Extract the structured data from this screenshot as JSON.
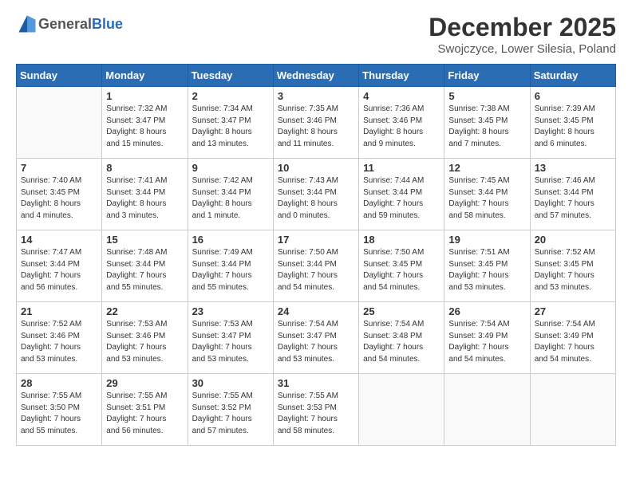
{
  "header": {
    "logo_general": "General",
    "logo_blue": "Blue",
    "month": "December 2025",
    "location": "Swojczyce, Lower Silesia, Poland"
  },
  "weekdays": [
    "Sunday",
    "Monday",
    "Tuesday",
    "Wednesday",
    "Thursday",
    "Friday",
    "Saturday"
  ],
  "weeks": [
    [
      {
        "day": "",
        "info": ""
      },
      {
        "day": "1",
        "info": "Sunrise: 7:32 AM\nSunset: 3:47 PM\nDaylight: 8 hours\nand 15 minutes."
      },
      {
        "day": "2",
        "info": "Sunrise: 7:34 AM\nSunset: 3:47 PM\nDaylight: 8 hours\nand 13 minutes."
      },
      {
        "day": "3",
        "info": "Sunrise: 7:35 AM\nSunset: 3:46 PM\nDaylight: 8 hours\nand 11 minutes."
      },
      {
        "day": "4",
        "info": "Sunrise: 7:36 AM\nSunset: 3:46 PM\nDaylight: 8 hours\nand 9 minutes."
      },
      {
        "day": "5",
        "info": "Sunrise: 7:38 AM\nSunset: 3:45 PM\nDaylight: 8 hours\nand 7 minutes."
      },
      {
        "day": "6",
        "info": "Sunrise: 7:39 AM\nSunset: 3:45 PM\nDaylight: 8 hours\nand 6 minutes."
      }
    ],
    [
      {
        "day": "7",
        "info": "Sunrise: 7:40 AM\nSunset: 3:45 PM\nDaylight: 8 hours\nand 4 minutes."
      },
      {
        "day": "8",
        "info": "Sunrise: 7:41 AM\nSunset: 3:44 PM\nDaylight: 8 hours\nand 3 minutes."
      },
      {
        "day": "9",
        "info": "Sunrise: 7:42 AM\nSunset: 3:44 PM\nDaylight: 8 hours\nand 1 minute."
      },
      {
        "day": "10",
        "info": "Sunrise: 7:43 AM\nSunset: 3:44 PM\nDaylight: 8 hours\nand 0 minutes."
      },
      {
        "day": "11",
        "info": "Sunrise: 7:44 AM\nSunset: 3:44 PM\nDaylight: 7 hours\nand 59 minutes."
      },
      {
        "day": "12",
        "info": "Sunrise: 7:45 AM\nSunset: 3:44 PM\nDaylight: 7 hours\nand 58 minutes."
      },
      {
        "day": "13",
        "info": "Sunrise: 7:46 AM\nSunset: 3:44 PM\nDaylight: 7 hours\nand 57 minutes."
      }
    ],
    [
      {
        "day": "14",
        "info": "Sunrise: 7:47 AM\nSunset: 3:44 PM\nDaylight: 7 hours\nand 56 minutes."
      },
      {
        "day": "15",
        "info": "Sunrise: 7:48 AM\nSunset: 3:44 PM\nDaylight: 7 hours\nand 55 minutes."
      },
      {
        "day": "16",
        "info": "Sunrise: 7:49 AM\nSunset: 3:44 PM\nDaylight: 7 hours\nand 55 minutes."
      },
      {
        "day": "17",
        "info": "Sunrise: 7:50 AM\nSunset: 3:44 PM\nDaylight: 7 hours\nand 54 minutes."
      },
      {
        "day": "18",
        "info": "Sunrise: 7:50 AM\nSunset: 3:45 PM\nDaylight: 7 hours\nand 54 minutes."
      },
      {
        "day": "19",
        "info": "Sunrise: 7:51 AM\nSunset: 3:45 PM\nDaylight: 7 hours\nand 53 minutes."
      },
      {
        "day": "20",
        "info": "Sunrise: 7:52 AM\nSunset: 3:45 PM\nDaylight: 7 hours\nand 53 minutes."
      }
    ],
    [
      {
        "day": "21",
        "info": "Sunrise: 7:52 AM\nSunset: 3:46 PM\nDaylight: 7 hours\nand 53 minutes."
      },
      {
        "day": "22",
        "info": "Sunrise: 7:53 AM\nSunset: 3:46 PM\nDaylight: 7 hours\nand 53 minutes."
      },
      {
        "day": "23",
        "info": "Sunrise: 7:53 AM\nSunset: 3:47 PM\nDaylight: 7 hours\nand 53 minutes."
      },
      {
        "day": "24",
        "info": "Sunrise: 7:54 AM\nSunset: 3:47 PM\nDaylight: 7 hours\nand 53 minutes."
      },
      {
        "day": "25",
        "info": "Sunrise: 7:54 AM\nSunset: 3:48 PM\nDaylight: 7 hours\nand 54 minutes."
      },
      {
        "day": "26",
        "info": "Sunrise: 7:54 AM\nSunset: 3:49 PM\nDaylight: 7 hours\nand 54 minutes."
      },
      {
        "day": "27",
        "info": "Sunrise: 7:54 AM\nSunset: 3:49 PM\nDaylight: 7 hours\nand 54 minutes."
      }
    ],
    [
      {
        "day": "28",
        "info": "Sunrise: 7:55 AM\nSunset: 3:50 PM\nDaylight: 7 hours\nand 55 minutes."
      },
      {
        "day": "29",
        "info": "Sunrise: 7:55 AM\nSunset: 3:51 PM\nDaylight: 7 hours\nand 56 minutes."
      },
      {
        "day": "30",
        "info": "Sunrise: 7:55 AM\nSunset: 3:52 PM\nDaylight: 7 hours\nand 57 minutes."
      },
      {
        "day": "31",
        "info": "Sunrise: 7:55 AM\nSunset: 3:53 PM\nDaylight: 7 hours\nand 58 minutes."
      },
      {
        "day": "",
        "info": ""
      },
      {
        "day": "",
        "info": ""
      },
      {
        "day": "",
        "info": ""
      }
    ]
  ]
}
